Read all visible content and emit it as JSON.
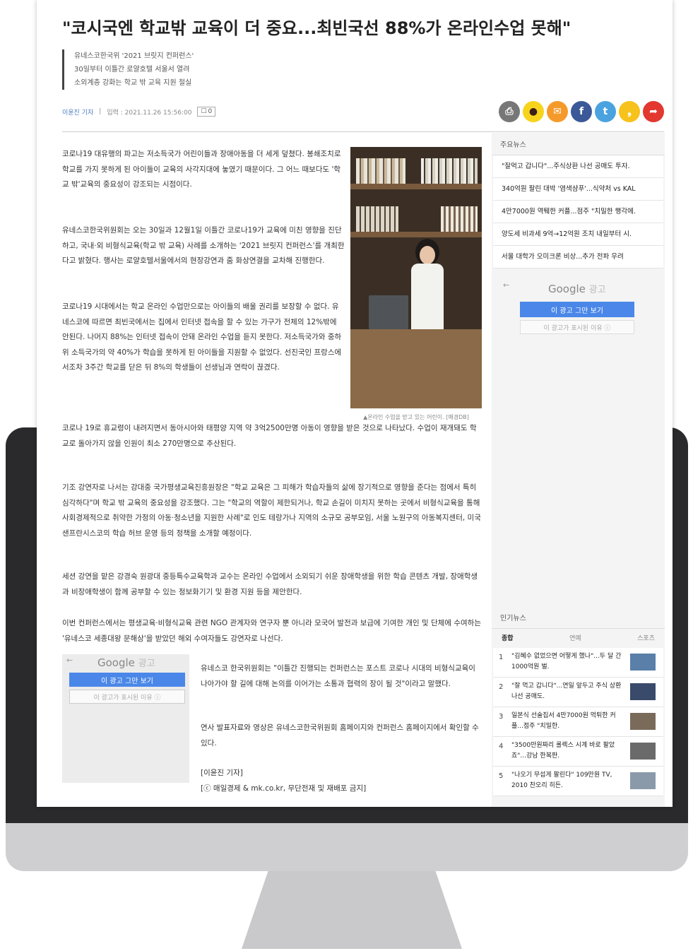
{
  "article": {
    "headline": "\"코시국엔 학교밖 교육이 더 중요...최빈국선 88%가 온라인수업 못해\"",
    "subheads": [
      "유네스코한국위 '2021 브릿지 컨퍼런스'",
      "30일부터 이틀간 로얄호텔 서울서 열려",
      "소외계층 강화는 학교 밖 교육 지원 절실"
    ],
    "reporter": "이윤진 기자",
    "published": "입력 : 2021.11.26 15:56:00",
    "comment_count": "0",
    "paragraphs": [
      "코로나19 대유행의 파고는 저소득국가 어린이들과 장애아동을 더 세게 덮쳤다. 봉쇄조치로 학교를 가지 못하게 된 아이들이 교육의 사각지대에 놓였기 때문이다. 그 어느 때보다도 '학교 밖'교육의 중요성이 강조되는 시점이다.",
      "유네스코한국위원회는 오는 30일과 12월1일 이틀간 코로나19가 교육에 미친 영향을 진단하고, 국내·외 비형식교육(학교 밖 교육) 사례를 소개하는 '2021 브릿지 컨퍼런스'를 개최한다고 밝혔다. 행사는 로얄호텔서울에서의 현장강연과 줌 화상연결을 교차해 진행한다.",
      "코로나19 시대에서는 학교 온라인 수업만으로는 아이들의 배울 권리를 보장할 수 없다. 유네스코에 따르면 최빈국에서는 집에서 인터넷 접속을 할 수 있는 가구가 전체의 12%밖에 안된다. 나머지 88%는 인터넷 접속이 안돼 온라인 수업을 듣지 못한다. 저소득국가와 중하위 소득국가의 약 40%가 학습을 못하게 된 아이들을 지원할 수 없었다. 선진국인 프랑스에서조차 3주간 학교를 닫은 뒤 8%의 학생들이 선생님과 연락이 끊겼다.",
      "코로나 19로 휴교령이 내려지면서 동아시아와 태평양 지역 약 3억2500만명 아동이 영향을 받은 것으로 나타났다. 수업이 재개돼도 학교로 돌아가지 않을 인원이 최소 270만명으로 추산된다.",
      "기조 강연자로 나서는 강대중 국가평생교육진흥원장은 \"학교 교육은 그 피해가 학습자들의 삶에 장기적으로 영향을 준다는 점에서 특히 심각하다\"며 학교 밖 교육의 중요성을 강조했다. 그는 \"학교의 역할이 제한되거나, 학교 손길이 미치지 못하는 곳에서 비형식교육을 통해 사회경제적으로 취약한 가정의 아동·청소년을 지원한 사례\"로 인도 테랑가나 지역의 소규모 공부모임, 서울 노원구의 아동복지센터, 미국 샌프란시스코의 학습 허브 운영 등의 정책을 소개할 예정이다.",
      "세션 강연을 맡은 강경숙 원광대 중등특수교육학과 교수는 온라인 수업에서 소외되기 쉬운 장애학생을 위한 학습 콘텐츠 개발, 장애학생과 비장애학생이 함께 공부할 수 있는 정보화기기 및 환경 지원 등을 제안한다.",
      "이번 컨퍼런스에서는 평생교육·비형식교육 관련 NGO 관계자와 연구자 뿐 아니라 모국어 발전과 보급에 기여한 개인 및 단체에 수여하는 '유네스코 세종대왕 문해상'을 받았던 해외 수여자들도 강연자로 나선다.",
      "유네스코 한국위원회는 \"이틀간 진행되는 컨퍼런스는 포스트 코로나 시대의 비형식교육이 나아가야 할 길에 대해 논의를 이어가는 소통과 협력의 장이 될 것\"이라고 말했다.",
      "연사 발표자료와 영상은 유네스코한국위원회 홈페이지와 컨퍼런스 홈페이지에서 확인할 수 있다."
    ],
    "signoff": "[이윤진 기자]",
    "copyright": "[ⓒ 매일경제 & mk.co.kr, 무단전재 및 재배포 금지]",
    "photo_caption": "▲온라인 수업을 받고 있는 어린이. [매경DB]"
  },
  "share_buttons": [
    {
      "icon": "print-icon",
      "glyph": "⎙",
      "color": "#777777"
    },
    {
      "icon": "kakaotalk-icon",
      "glyph": "●",
      "color": "#f7d31c"
    },
    {
      "icon": "mail-icon",
      "glyph": "✉",
      "color": "#f59a2a"
    },
    {
      "icon": "facebook-icon",
      "glyph": "f",
      "color": "#3b5998"
    },
    {
      "icon": "twitter-icon",
      "glyph": "t",
      "color": "#4aa3df"
    },
    {
      "icon": "kakaostory-icon",
      "glyph": "❟",
      "color": "#f7c21c"
    },
    {
      "icon": "share-icon",
      "glyph": "➦",
      "color": "#e2382f"
    }
  ],
  "ads": {
    "back": "←",
    "google": "Google",
    "label": "광고",
    "stop": "이 광고 그만 보기",
    "why": "이 광고가 표시된 이유 ⓘ"
  },
  "sidebar": {
    "main_news_title": "주요뉴스",
    "main_news": [
      "\"잘먹고 갑니다\"...주식상환 나선 공매도 투자.",
      "340억원 팔린 대박 '염색샴푸'...식약처 vs KAL",
      "4만7000원 역퉤한 커플...점주 \"치밀한 행각에.",
      "양도세 비과세 9억→12억원 조치 내일부터 시.",
      "서울 대학가 오미크론 비상...추가 전파 우려"
    ],
    "popular_title": "인기뉴스",
    "popular_tabs": [
      "종합",
      "연예",
      "스포츠"
    ],
    "popular": [
      {
        "num": "1",
        "text": "\"김혜수 없었으면 어떻게 했나\"...두 달 간 1000억원 벌."
      },
      {
        "num": "2",
        "text": "\"잘 먹고 갑니다\"...연일 앞두고 주식 상환 나선 공매도."
      },
      {
        "num": "3",
        "text": "일본식 선술집서 4만7000원 먹튀한 커플...점주 \"치밀한."
      },
      {
        "num": "4",
        "text": "\"3500만원짜리 롤렉스 시계 바로 팔았죠\"...강남 한복판."
      },
      {
        "num": "5",
        "text": "\"나오기 무섭게 팔린다\" 109만원 TV, 2010 찬오리 히든."
      }
    ]
  }
}
